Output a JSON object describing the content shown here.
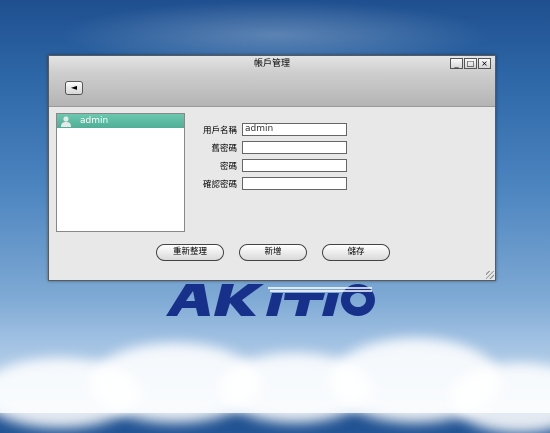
{
  "window": {
    "title": "帳戶管理"
  },
  "window_controls": {
    "minimize": "_",
    "maximize": "□",
    "close": "×"
  },
  "toolbar": {
    "back_glyph": "◄"
  },
  "user_list": {
    "items": [
      {
        "name": "admin",
        "selected": true
      }
    ]
  },
  "form": {
    "username_label": "用戶名稱",
    "username_value": "admin",
    "old_password_label": "舊密碼",
    "password_label": "密碼",
    "confirm_password_label": "確認密碼"
  },
  "buttons": {
    "reset": "重新整理",
    "add": "新增",
    "save": "儲存"
  },
  "background": {
    "logo_text": "AKiTiO"
  },
  "colors": {
    "selection": "#5bbea3",
    "sky_top": "#1f4f8f",
    "logo": "#17318a"
  }
}
